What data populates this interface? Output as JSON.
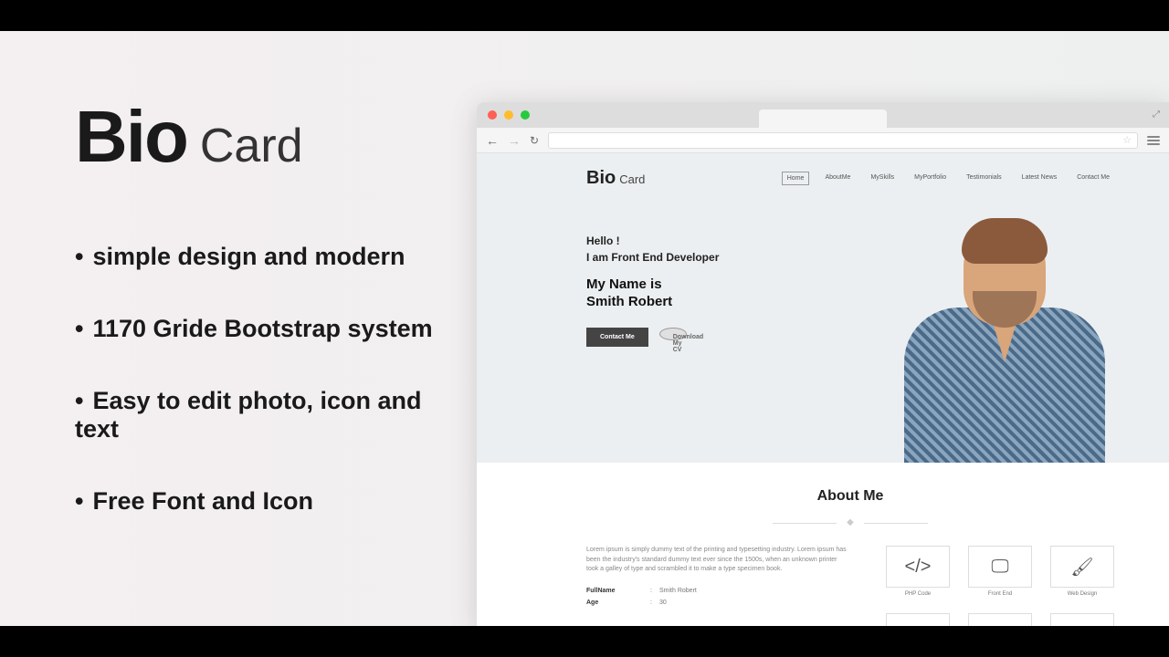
{
  "logo": {
    "bio": "Bio",
    "card": "Card"
  },
  "bullets": [
    "simple design and modern",
    "1170 Gride Bootstrap system",
    "Easy to edit photo, icon and text",
    "Free Font and Icon"
  ],
  "page": {
    "logo": {
      "bio": "Bio",
      "card": "Card"
    },
    "nav": [
      "Home",
      "AboutMe",
      "MySkills",
      "MyPortfolio",
      "Testimonials",
      "Latest News",
      "Contact Me"
    ],
    "hero": {
      "hello": "Hello !",
      "iam": "I am Front End Developer",
      "myname": "My Name is",
      "name": "Smith Robert",
      "contact_btn": "Contact Me",
      "download_btn": "Download My CV"
    },
    "about": {
      "title": "About Me",
      "desc": "Lorem ipsum is simply dummy text of the printing and typesetting industry. Lorem ipsum has been the industry's standard dummy text ever since the 1500s, when an unknown printer took a galley of type and scrambled it to make a type specimen book.",
      "info": [
        {
          "label": "FullName",
          "value": "Smith Robert"
        },
        {
          "label": "Age",
          "value": "30"
        }
      ],
      "skills": [
        {
          "icon": "code-icon",
          "label": "PHP Code"
        },
        {
          "icon": "monitor-icon",
          "label": "Front End"
        },
        {
          "icon": "brush-icon",
          "label": "Web Design"
        },
        {
          "icon": "html5-icon",
          "label": ""
        },
        {
          "icon": "wordpress-icon",
          "label": ""
        },
        {
          "icon": "css3-icon",
          "label": ""
        }
      ]
    }
  }
}
